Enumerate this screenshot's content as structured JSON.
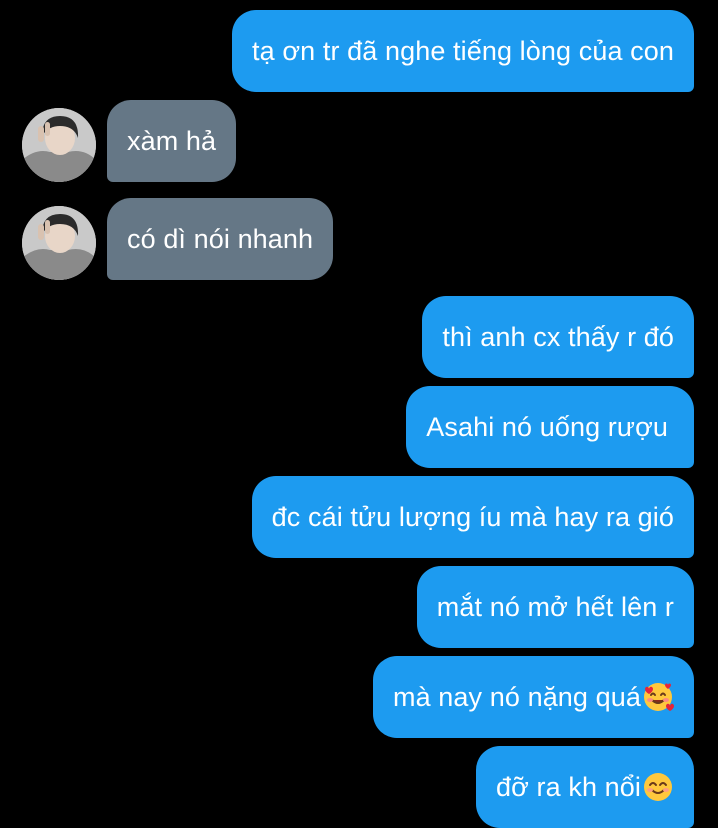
{
  "conversation": {
    "messages": [
      {
        "sender": "me",
        "text": "tạ ơn tr đã nghe tiếng lòng của con"
      },
      {
        "sender": "them",
        "text": "xàm hả"
      },
      {
        "sender": "them",
        "text": "có dì nói nhanh"
      },
      {
        "sender": "me",
        "text": "thì anh cx thấy r đó"
      },
      {
        "sender": "me",
        "text": "Asahi nó uống rượu"
      },
      {
        "sender": "me",
        "text": "đc cái tửu lượng íu mà hay ra gió"
      },
      {
        "sender": "me",
        "text": "mắt nó mở hết lên r"
      },
      {
        "sender": "me",
        "text": "mà nay nó nặng quá",
        "emoji": "smiling-face-with-hearts-emoji"
      },
      {
        "sender": "me",
        "text": "đỡ ra kh nổi",
        "emoji": "smiling-face-with-smiling-eyes-emoji"
      }
    ]
  },
  "colors": {
    "background": "#000000",
    "outgoing_bubble": "#1d9bf0",
    "incoming_bubble": "#657786",
    "text": "#ffffff"
  }
}
